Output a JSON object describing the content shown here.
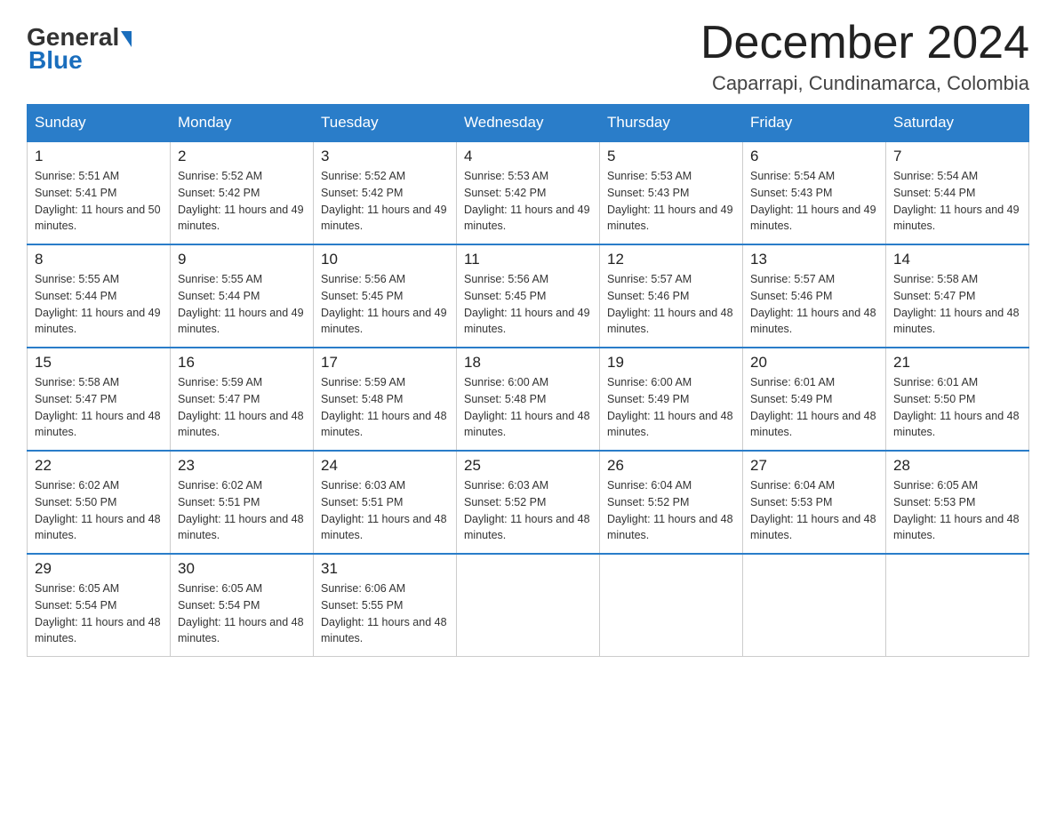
{
  "header": {
    "logo_general": "General",
    "logo_blue": "Blue",
    "month_title": "December 2024",
    "location": "Caparrapi, Cundinamarca, Colombia"
  },
  "days_of_week": [
    "Sunday",
    "Monday",
    "Tuesday",
    "Wednesday",
    "Thursday",
    "Friday",
    "Saturday"
  ],
  "weeks": [
    [
      {
        "day": "1",
        "sunrise": "Sunrise: 5:51 AM",
        "sunset": "Sunset: 5:41 PM",
        "daylight": "Daylight: 11 hours and 50 minutes."
      },
      {
        "day": "2",
        "sunrise": "Sunrise: 5:52 AM",
        "sunset": "Sunset: 5:42 PM",
        "daylight": "Daylight: 11 hours and 49 minutes."
      },
      {
        "day": "3",
        "sunrise": "Sunrise: 5:52 AM",
        "sunset": "Sunset: 5:42 PM",
        "daylight": "Daylight: 11 hours and 49 minutes."
      },
      {
        "day": "4",
        "sunrise": "Sunrise: 5:53 AM",
        "sunset": "Sunset: 5:42 PM",
        "daylight": "Daylight: 11 hours and 49 minutes."
      },
      {
        "day": "5",
        "sunrise": "Sunrise: 5:53 AM",
        "sunset": "Sunset: 5:43 PM",
        "daylight": "Daylight: 11 hours and 49 minutes."
      },
      {
        "day": "6",
        "sunrise": "Sunrise: 5:54 AM",
        "sunset": "Sunset: 5:43 PM",
        "daylight": "Daylight: 11 hours and 49 minutes."
      },
      {
        "day": "7",
        "sunrise": "Sunrise: 5:54 AM",
        "sunset": "Sunset: 5:44 PM",
        "daylight": "Daylight: 11 hours and 49 minutes."
      }
    ],
    [
      {
        "day": "8",
        "sunrise": "Sunrise: 5:55 AM",
        "sunset": "Sunset: 5:44 PM",
        "daylight": "Daylight: 11 hours and 49 minutes."
      },
      {
        "day": "9",
        "sunrise": "Sunrise: 5:55 AM",
        "sunset": "Sunset: 5:44 PM",
        "daylight": "Daylight: 11 hours and 49 minutes."
      },
      {
        "day": "10",
        "sunrise": "Sunrise: 5:56 AM",
        "sunset": "Sunset: 5:45 PM",
        "daylight": "Daylight: 11 hours and 49 minutes."
      },
      {
        "day": "11",
        "sunrise": "Sunrise: 5:56 AM",
        "sunset": "Sunset: 5:45 PM",
        "daylight": "Daylight: 11 hours and 49 minutes."
      },
      {
        "day": "12",
        "sunrise": "Sunrise: 5:57 AM",
        "sunset": "Sunset: 5:46 PM",
        "daylight": "Daylight: 11 hours and 48 minutes."
      },
      {
        "day": "13",
        "sunrise": "Sunrise: 5:57 AM",
        "sunset": "Sunset: 5:46 PM",
        "daylight": "Daylight: 11 hours and 48 minutes."
      },
      {
        "day": "14",
        "sunrise": "Sunrise: 5:58 AM",
        "sunset": "Sunset: 5:47 PM",
        "daylight": "Daylight: 11 hours and 48 minutes."
      }
    ],
    [
      {
        "day": "15",
        "sunrise": "Sunrise: 5:58 AM",
        "sunset": "Sunset: 5:47 PM",
        "daylight": "Daylight: 11 hours and 48 minutes."
      },
      {
        "day": "16",
        "sunrise": "Sunrise: 5:59 AM",
        "sunset": "Sunset: 5:47 PM",
        "daylight": "Daylight: 11 hours and 48 minutes."
      },
      {
        "day": "17",
        "sunrise": "Sunrise: 5:59 AM",
        "sunset": "Sunset: 5:48 PM",
        "daylight": "Daylight: 11 hours and 48 minutes."
      },
      {
        "day": "18",
        "sunrise": "Sunrise: 6:00 AM",
        "sunset": "Sunset: 5:48 PM",
        "daylight": "Daylight: 11 hours and 48 minutes."
      },
      {
        "day": "19",
        "sunrise": "Sunrise: 6:00 AM",
        "sunset": "Sunset: 5:49 PM",
        "daylight": "Daylight: 11 hours and 48 minutes."
      },
      {
        "day": "20",
        "sunrise": "Sunrise: 6:01 AM",
        "sunset": "Sunset: 5:49 PM",
        "daylight": "Daylight: 11 hours and 48 minutes."
      },
      {
        "day": "21",
        "sunrise": "Sunrise: 6:01 AM",
        "sunset": "Sunset: 5:50 PM",
        "daylight": "Daylight: 11 hours and 48 minutes."
      }
    ],
    [
      {
        "day": "22",
        "sunrise": "Sunrise: 6:02 AM",
        "sunset": "Sunset: 5:50 PM",
        "daylight": "Daylight: 11 hours and 48 minutes."
      },
      {
        "day": "23",
        "sunrise": "Sunrise: 6:02 AM",
        "sunset": "Sunset: 5:51 PM",
        "daylight": "Daylight: 11 hours and 48 minutes."
      },
      {
        "day": "24",
        "sunrise": "Sunrise: 6:03 AM",
        "sunset": "Sunset: 5:51 PM",
        "daylight": "Daylight: 11 hours and 48 minutes."
      },
      {
        "day": "25",
        "sunrise": "Sunrise: 6:03 AM",
        "sunset": "Sunset: 5:52 PM",
        "daylight": "Daylight: 11 hours and 48 minutes."
      },
      {
        "day": "26",
        "sunrise": "Sunrise: 6:04 AM",
        "sunset": "Sunset: 5:52 PM",
        "daylight": "Daylight: 11 hours and 48 minutes."
      },
      {
        "day": "27",
        "sunrise": "Sunrise: 6:04 AM",
        "sunset": "Sunset: 5:53 PM",
        "daylight": "Daylight: 11 hours and 48 minutes."
      },
      {
        "day": "28",
        "sunrise": "Sunrise: 6:05 AM",
        "sunset": "Sunset: 5:53 PM",
        "daylight": "Daylight: 11 hours and 48 minutes."
      }
    ],
    [
      {
        "day": "29",
        "sunrise": "Sunrise: 6:05 AM",
        "sunset": "Sunset: 5:54 PM",
        "daylight": "Daylight: 11 hours and 48 minutes."
      },
      {
        "day": "30",
        "sunrise": "Sunrise: 6:05 AM",
        "sunset": "Sunset: 5:54 PM",
        "daylight": "Daylight: 11 hours and 48 minutes."
      },
      {
        "day": "31",
        "sunrise": "Sunrise: 6:06 AM",
        "sunset": "Sunset: 5:55 PM",
        "daylight": "Daylight: 11 hours and 48 minutes."
      },
      null,
      null,
      null,
      null
    ]
  ]
}
